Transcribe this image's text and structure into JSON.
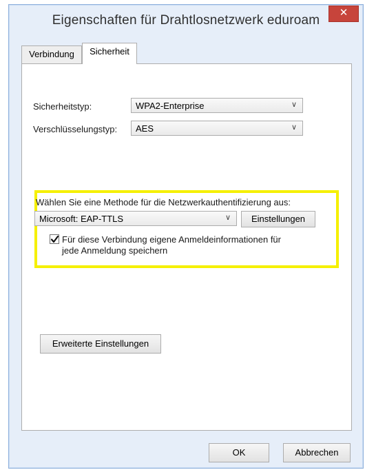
{
  "window": {
    "title": "Eigenschaften für Drahtlosnetzwerk eduroam",
    "close_icon": "close-icon",
    "close_glyph": "✕"
  },
  "tabs": [
    {
      "label": "Verbindung",
      "selected": false
    },
    {
      "label": "Sicherheit",
      "selected": true
    }
  ],
  "security": {
    "type_label": "Sicherheitstyp:",
    "type_value": "WPA2-Enterprise",
    "encryption_label": "Verschlüsselungstyp:",
    "encryption_value": "AES"
  },
  "auth": {
    "method_label": "Wählen Sie eine Methode für die Netzwerkauthentifizierung aus:",
    "method_value": "Microsoft: EAP-TTLS",
    "settings_button": "Einstellungen",
    "remember_checked": true,
    "remember_label_line1": "Für diese Verbindung eigene Anmeldeinformationen für",
    "remember_label_line2": "jede Anmeldung speichern",
    "highlight_color": "#f5f000"
  },
  "advanced_button": "Erweiterte Einstellungen",
  "footer": {
    "ok_label": "OK",
    "cancel_label": "Abbrechen"
  },
  "icons": {
    "dropdown": "chevron-down-icon",
    "check": "checkmark-icon"
  },
  "chevron_glyph": "∨"
}
